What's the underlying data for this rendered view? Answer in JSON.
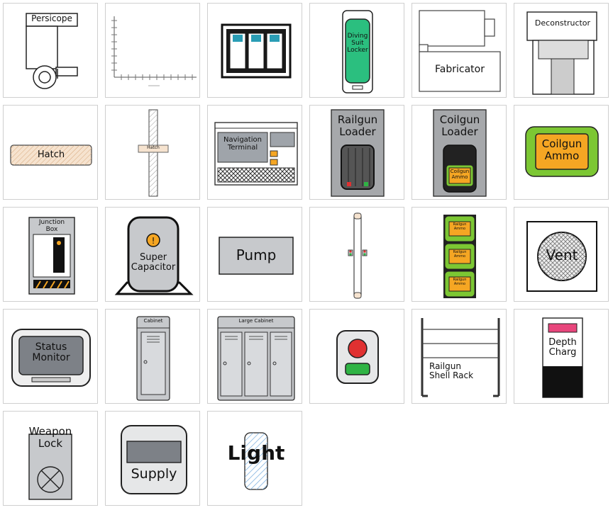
{
  "tiles": [
    {
      "id": "periscope",
      "label": "Persicope"
    },
    {
      "id": "sonar-chart",
      "label": "",
      "axis_caption": "bottom"
    },
    {
      "id": "battery-panel",
      "label": ""
    },
    {
      "id": "diving-suit-locker",
      "label": "Diving Suit Locker",
      "lines": [
        "Diving",
        "Suit",
        "Locker"
      ]
    },
    {
      "id": "fabricator",
      "label": "Fabricator"
    },
    {
      "id": "deconstructor",
      "label": "Deconstructor"
    },
    {
      "id": "hatch",
      "label": "Hatch"
    },
    {
      "id": "vertical-hatch",
      "label": "Hatch"
    },
    {
      "id": "navigation-terminal",
      "label": "Navigation Terminal",
      "lines": [
        "Navigation",
        "Terminal"
      ]
    },
    {
      "id": "railgun-loader",
      "label": "Railgun Loader",
      "lines": [
        "Railgun",
        "Loader"
      ]
    },
    {
      "id": "coilgun-loader",
      "label": "Coilgun Loader",
      "lines": [
        "Coilgun",
        "Loader"
      ],
      "inner": [
        "Coilgun",
        "Ammo"
      ]
    },
    {
      "id": "coilgun-ammo",
      "label": "Coilgun Ammo",
      "lines": [
        "Coilgun",
        "Ammo"
      ]
    },
    {
      "id": "junction-box",
      "label": "Junction Box",
      "lines": [
        "Junction",
        "Box"
      ]
    },
    {
      "id": "super-capacitor",
      "label": "Super Capacitor",
      "lines": [
        "Super",
        "Capacitor"
      ]
    },
    {
      "id": "pump",
      "label": "Pump"
    },
    {
      "id": "door",
      "label": ""
    },
    {
      "id": "railgun-ammo-stack",
      "label": "Railgun Ammo",
      "lines": [
        "Railgun",
        "Ammo"
      ]
    },
    {
      "id": "vent",
      "label": "Vent"
    },
    {
      "id": "status-monitor",
      "label": "Status Monitor",
      "lines": [
        "Status",
        "Monitor"
      ]
    },
    {
      "id": "cabinet",
      "label": "Cabinet"
    },
    {
      "id": "large-cabinet",
      "label": "Large Cabinet"
    },
    {
      "id": "button",
      "label": ""
    },
    {
      "id": "railgun-shell-rack",
      "label": "Railgun Shell Rack",
      "lines": [
        "Railgun",
        "Shell Rack"
      ]
    },
    {
      "id": "depth-charge",
      "label": "Depth Charg",
      "lines": [
        "Depth",
        "Charg"
      ]
    },
    {
      "id": "weapon-lock",
      "label": "Weapon Lock",
      "lines": [
        "Weapon",
        "Lock"
      ]
    },
    {
      "id": "supply",
      "label": "Supply"
    },
    {
      "id": "light",
      "label": "Light"
    }
  ],
  "colors": {
    "locker_green": "#2bbf7f",
    "ammo_green": "#7cc733",
    "ammo_orange": "#f5a623",
    "battery_cyan": "#2a9db5",
    "hatch_fill": "#f6e3cf",
    "grey": "#c7c9cc",
    "dark": "#222222",
    "red": "#e03131",
    "green_btn": "#2fb344",
    "depth_pink": "#e8467c",
    "light_blue": "#6fa8dc"
  }
}
